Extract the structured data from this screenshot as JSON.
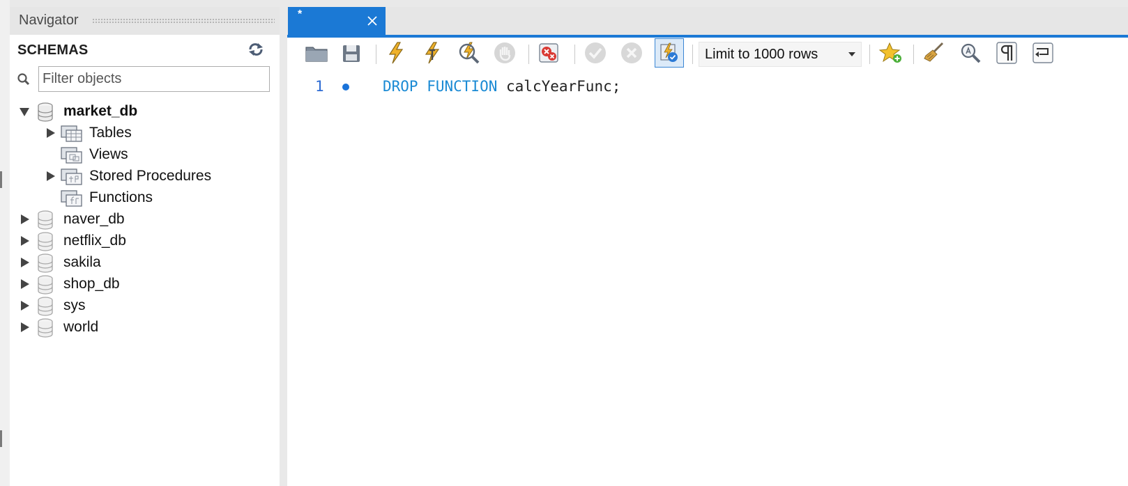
{
  "navigator": {
    "title": "Navigator",
    "schemas_label": "SCHEMAS",
    "filter_placeholder": "Filter objects",
    "schemas": [
      {
        "name": "market_db",
        "expanded": true,
        "bold": true,
        "children": [
          {
            "label": "Tables",
            "expandable": true
          },
          {
            "label": "Views",
            "expandable": false
          },
          {
            "label": "Stored Procedures",
            "expandable": true
          },
          {
            "label": "Functions",
            "expandable": false
          }
        ]
      },
      {
        "name": "naver_db",
        "expanded": false
      },
      {
        "name": "netflix_db",
        "expanded": false
      },
      {
        "name": "sakila",
        "expanded": false
      },
      {
        "name": "shop_db",
        "expanded": false
      },
      {
        "name": "sys",
        "expanded": false
      },
      {
        "name": "world",
        "expanded": false
      }
    ]
  },
  "editor": {
    "tab": {
      "title": "*"
    },
    "toolbar": {
      "limit_label": "Limit to 1000 rows"
    },
    "lines": [
      {
        "number": "1",
        "keywords": "DROP FUNCTION",
        "rest": " calcYearFunc;"
      }
    ]
  },
  "colors": {
    "accent": "#1b79d5",
    "keyword": "#1a8ad4"
  }
}
